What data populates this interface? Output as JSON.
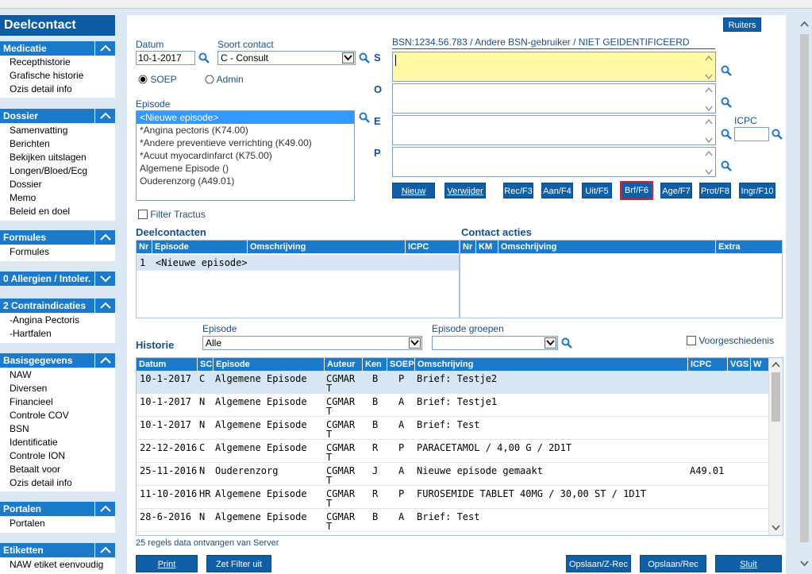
{
  "sidebar": {
    "title": "Deelcontact",
    "sections": [
      {
        "header": "Medicatie",
        "items": [
          "Recepthistorie",
          "Grafische historie",
          "Ozis detail info"
        ]
      },
      {
        "header": "Dossier",
        "items": [
          "Samenvatting",
          "Berichten",
          "Bekijken uitslagen",
          "Longen/Bloed/Ecg",
          "Dossier",
          "Memo",
          "Beleid en doel"
        ]
      },
      {
        "header": "Formules",
        "items": [
          "Formules"
        ]
      },
      {
        "header": "0 Allergien / Intoler.",
        "items": []
      },
      {
        "header": "2 Contraindicaties",
        "items": [
          "-Angina Pectoris",
          "-Hartfalen"
        ]
      },
      {
        "header": "Basisgegevens",
        "items": [
          "NAW",
          "Diversen",
          "Financieel",
          "Controle COV",
          "BSN",
          "Identificatie",
          "Controle ION",
          "Betaalt voor",
          "Ozis detail info"
        ]
      },
      {
        "header": "Portalen",
        "items": [
          "Portalen"
        ]
      },
      {
        "header": "Etiketten",
        "items": [
          "NAW etiket eenvoudig"
        ]
      }
    ]
  },
  "form": {
    "datum_label": "Datum",
    "datum_value": "10-1-2017",
    "soort_label": "Soort contact",
    "soort_value": "C - Consult",
    "radio_soep": "SOEP",
    "radio_admin": "Admin",
    "episode_label": "Episode",
    "episodes": [
      "<Nieuwe episode>",
      "*Angina pectoris (K74.00)",
      "*Andere preventieve verrichting (K49.00)",
      "*Acuut myocardinfarct (K75.00)",
      "Algemene Episode ()",
      "Ouderenzorg (A49.01)"
    ],
    "filter_tractus": "Filter Tractus",
    "bsn_text": "BSN:1234.56.783 / Andere BSN-gebruiker / NIET GEIDENTIFICEERD",
    "soep_labels": [
      "S",
      "O",
      "E",
      "P"
    ],
    "icpc_label": "ICPC",
    "ruiters": "Ruiters"
  },
  "buttons": [
    "Nieuw",
    "Verwijder",
    "Rec/F3",
    "Aan/F4",
    "Uit/F5",
    "Brf/F6",
    "Age/F7",
    "Prot/F8",
    "Ingr/F10"
  ],
  "deelcontacten": {
    "title": "Deelcontacten",
    "columns": [
      "Nr",
      "Episode",
      "Omschrijving",
      "ICPC"
    ],
    "rows": [
      {
        "nr": "1",
        "episode": "<Nieuwe episode>"
      }
    ]
  },
  "contact_acties": {
    "title": "Contact acties",
    "columns": [
      "Nr",
      "KM",
      "Omschrijving",
      "Extra"
    ]
  },
  "historie": {
    "title": "Historie",
    "episode_label": "Episode",
    "episode_value": "Alle",
    "groepen_label": "Episode groepen",
    "voorgeschiedenis": "Voorgeschiedenis",
    "columns": [
      "Datum",
      "SC",
      "Episode",
      "Auteur",
      "Ken",
      "SOEP",
      "Omschrijving",
      "ICPC",
      "VGS",
      "W"
    ],
    "rows": [
      {
        "datum": "10-1-2017",
        "sc": "C",
        "episode": "Algemene Episode",
        "auteur1": "CGMAR",
        "auteur2": "T",
        "ken": "B",
        "soep": "P",
        "omschrijving": "Brief: Testje2",
        "icpc": ""
      },
      {
        "datum": "10-1-2017",
        "sc": "N",
        "episode": "Algemene Episode",
        "auteur1": "CGMAR",
        "auteur2": "T",
        "ken": "B",
        "soep": "A",
        "omschrijving": "Brief: Testje1",
        "icpc": ""
      },
      {
        "datum": "10-1-2017",
        "sc": "N",
        "episode": "Algemene Episode",
        "auteur1": "CGMAR",
        "auteur2": "T",
        "ken": "B",
        "soep": "A",
        "omschrijving": "Brief: Test",
        "icpc": ""
      },
      {
        "datum": "22-12-2016",
        "sc": "C",
        "episode": "Algemene Episode",
        "auteur1": "CGMAR",
        "auteur2": "T",
        "ken": "R",
        "soep": "P",
        "omschrijving": "PARACETAMOL / 4,00 G / 2D1T",
        "icpc": ""
      },
      {
        "datum": "25-11-2016",
        "sc": "N",
        "episode": "Ouderenzorg",
        "auteur1": "CGMAR",
        "auteur2": "T",
        "ken": "J",
        "soep": "A",
        "omschrijving": "Nieuwe episode gemaakt",
        "icpc": "A49.01"
      },
      {
        "datum": "11-10-2016",
        "sc": "HR",
        "episode": "Algemene Episode",
        "auteur1": "CGMAR",
        "auteur2": "T",
        "ken": "R",
        "soep": "P",
        "omschrijving": "FUROSEMIDE TABLET 40MG / 30,00 ST / 1D1T",
        "icpc": ""
      },
      {
        "datum": "28-6-2016",
        "sc": "N",
        "episode": "Algemene Episode",
        "auteur1": "CGMAR",
        "auteur2": "T",
        "ken": "B",
        "soep": "A",
        "omschrijving": "Brief: Test",
        "icpc": ""
      }
    ],
    "status": "25 regels data ontvangen van Server"
  },
  "footer": {
    "print": "Print",
    "zet_filter": "Zet Filter uit",
    "opslaan_zrec": "Opslaan/Z-Rec",
    "opslaan_rec": "Opslaan/Rec",
    "sluit": "Sluit"
  },
  "colors": {
    "accent": "#1b7ac9",
    "title": "#0d5ba3",
    "highlight": "#fff9a6",
    "selected": "#3399ff",
    "brf_border": "#e02020"
  }
}
